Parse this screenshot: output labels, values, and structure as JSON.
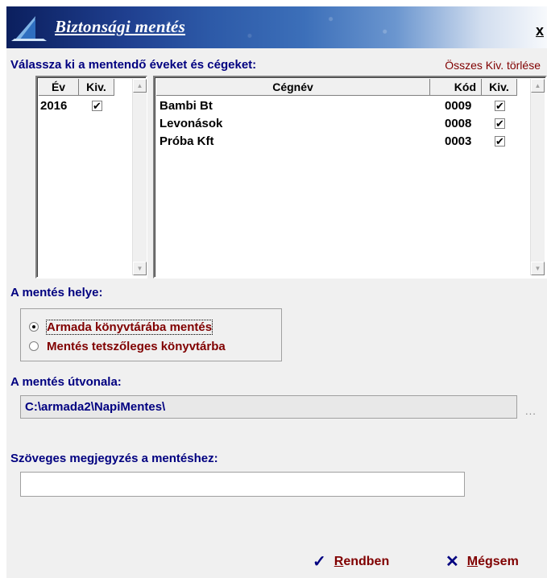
{
  "dialog": {
    "title": "Biztonsági mentés",
    "close_label": "x"
  },
  "selection": {
    "label": "Válassza ki a mentendő éveket és cégeket:",
    "clear_all": "Összes Kiv. törlése"
  },
  "years_table": {
    "headers": [
      "Év",
      "Kiv."
    ],
    "rows": [
      {
        "year": "2016",
        "checked": true
      }
    ]
  },
  "companies_table": {
    "headers": [
      "Cégnév",
      "Kód",
      "Kiv."
    ],
    "rows": [
      {
        "name": "Bambi Bt",
        "code": "0009",
        "checked": true
      },
      {
        "name": "Levonások",
        "code": "0008",
        "checked": true
      },
      {
        "name": "Próba Kft",
        "code": "0003",
        "checked": true
      }
    ]
  },
  "location": {
    "label": "A mentés helye:",
    "options": [
      {
        "label": "Armada könyvtárába mentés",
        "selected": true
      },
      {
        "label": "Mentés tetszőleges könyvtárba",
        "selected": false
      }
    ]
  },
  "path": {
    "label": "A mentés útvonala:",
    "value": "C:\\armada2\\NapiMentes\\",
    "browse": "..."
  },
  "note": {
    "label": "Szöveges megjegyzés a mentéshez:",
    "value": ""
  },
  "buttons": {
    "ok_first": "R",
    "ok_rest": "endben",
    "cancel_first": "M",
    "cancel_rest": "égsem"
  },
  "colors": {
    "label_blue": "#000080",
    "accent_red": "#800000"
  }
}
